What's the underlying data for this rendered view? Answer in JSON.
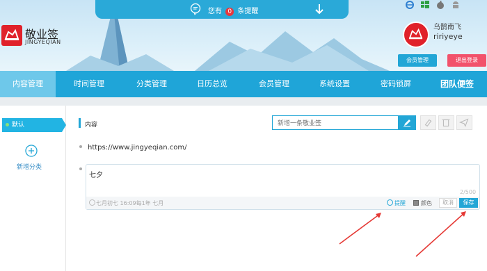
{
  "notice": {
    "prefix": "您有",
    "count": "0",
    "suffix": "条提醒"
  },
  "platforms": [
    "ie-icon",
    "windows-icon",
    "apple-icon",
    "android-icon"
  ],
  "brand": {
    "name": "敬业签",
    "subtitle": "JINGYEQIAN"
  },
  "user": {
    "name": "乌鹊南飞",
    "id": "ririyeye"
  },
  "header_buttons": {
    "member": "会员管理",
    "logout": "退出登录"
  },
  "nav": [
    {
      "label": "内容管理",
      "active": true
    },
    {
      "label": "时间管理"
    },
    {
      "label": "分类管理"
    },
    {
      "label": "日历总览"
    },
    {
      "label": "会员管理"
    },
    {
      "label": "系统设置"
    },
    {
      "label": "密码锁屏"
    },
    {
      "label": "团队便签"
    }
  ],
  "sidebar": {
    "default_category": "默认",
    "add_category": "新增分类"
  },
  "main": {
    "section_title": "内容",
    "input_placeholder": "新增一条敬业签",
    "note1": "https://www.jingyeqian.com/",
    "editing": {
      "text": "七夕",
      "char_count": "2/500",
      "time": "七月初七 16:09每1年 七月",
      "remind": "提醒",
      "color": "颜色",
      "cancel": "取消",
      "save": "保存"
    }
  },
  "colors": {
    "accent": "#22a6d6",
    "nav_bg": "#1fa5d8",
    "logo_red": "#e0212a",
    "logout_pink": "#f2526b"
  }
}
